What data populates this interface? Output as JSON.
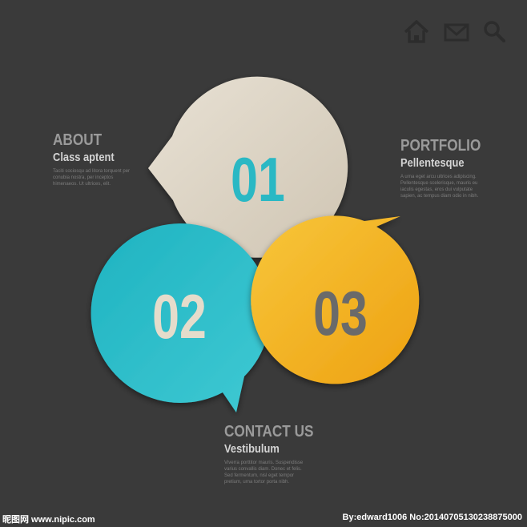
{
  "icons": {
    "home": "home-icon",
    "mail": "mail-icon",
    "search": "search-icon"
  },
  "bubbles": [
    {
      "number": "01",
      "color": "#dcd3c4",
      "number_color": "#2ab8c4"
    },
    {
      "number": "02",
      "color": "#2ab8c4",
      "number_color": "#e5dccb"
    },
    {
      "number": "03",
      "color": "#f3b21a",
      "number_color": "#6a6a6a"
    }
  ],
  "about": {
    "title": "ABOUT",
    "subtitle": "Class aptent",
    "body": "Taciti sociosqu ad litora torquent per conubia nostra, per inceptos himenaeos. Ut ultrices, elit."
  },
  "portfolio": {
    "title": "PORTFOLIO",
    "subtitle": "Pellentesque",
    "body": "A urna eget arcu ultrices adipiscing. Pellentesque scelerisque, mauris eu iaculis egestas, eros dui vulputate sapien, ac tempus diam odio in nibh."
  },
  "contact": {
    "title": "CONTACT US",
    "subtitle": "Vestibulum",
    "body": "Viverra porttitor mauris. Suspendisse varius convallis diam. Donec et felis. Sed fermentum, nisl eget tempor pretium, urna tortor porta nibh."
  },
  "footer": {
    "left": "昵图网 www.nipic.com",
    "right": "By:edward1006 No:20140705130238875000"
  }
}
